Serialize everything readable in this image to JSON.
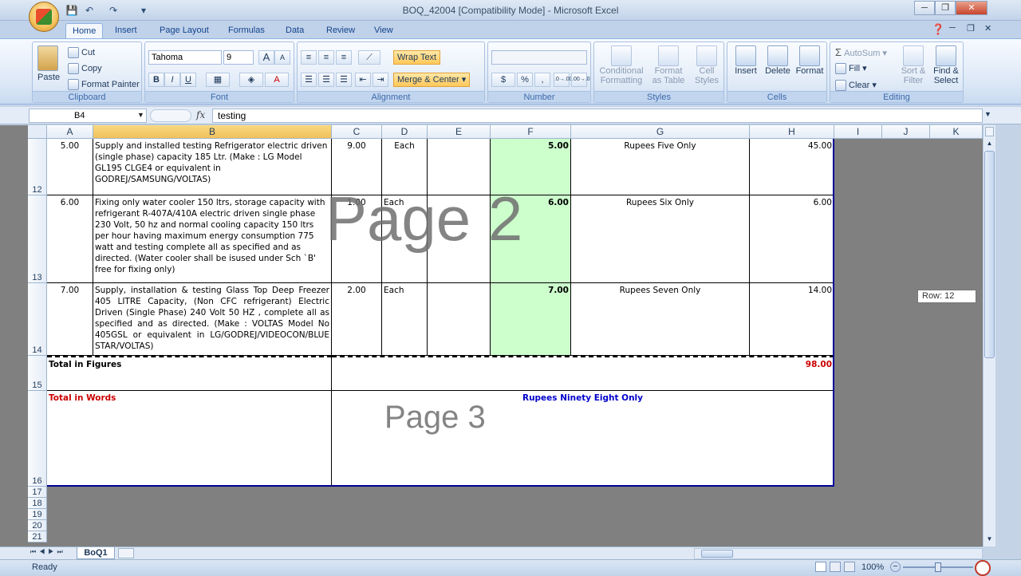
{
  "window": {
    "title": "BOQ_42004  [Compatibility Mode] - Microsoft Excel",
    "minimize": "─",
    "restore": "❐",
    "close": "✕"
  },
  "quick_access": {
    "save": "💾",
    "undo": "↶",
    "redo": "↷",
    "customize": "▾"
  },
  "tabs": [
    "Home",
    "Insert",
    "Page Layout",
    "Formulas",
    "Data",
    "Review",
    "View"
  ],
  "ribbon": {
    "clipboard": {
      "label": "Clipboard",
      "paste": "Paste",
      "cut": "Cut",
      "copy": "Copy",
      "format_painter": "Format Painter"
    },
    "font": {
      "label": "Font",
      "name": "Tahoma",
      "size": "9",
      "grow": "A",
      "shrink": "A",
      "bold": "B",
      "italic": "I",
      "underline": "U",
      "font_color": "A"
    },
    "alignment": {
      "label": "Alignment",
      "wrap_text": "Wrap Text",
      "merge_center": "Merge & Center"
    },
    "number": {
      "label": "Number",
      "currency": "$",
      "percent": "%",
      "comma": ",",
      "inc_dec": ".0→.00",
      "dec_dec": ".00→.0"
    },
    "styles": {
      "label": "Styles",
      "conditional": [
        "Conditional",
        "Formatting"
      ],
      "format_table": [
        "Format",
        "as Table"
      ],
      "cell_styles": [
        "Cell",
        "Styles"
      ]
    },
    "cells": {
      "label": "Cells",
      "insert": "Insert",
      "delete": "Delete",
      "format": "Format"
    },
    "editing": {
      "label": "Editing",
      "autosum": "AutoSum",
      "fill": "Fill",
      "clear": "Clear",
      "sort_filter": [
        "Sort &",
        "Filter"
      ],
      "find_select": [
        "Find &",
        "Select"
      ]
    }
  },
  "formula_bar": {
    "name_box": "B4",
    "fx": "fx",
    "value": "testing"
  },
  "columns": [
    "A",
    "B",
    "C",
    "D",
    "E",
    "F",
    "G",
    "H",
    "I",
    "J",
    "K"
  ],
  "rows": [
    {
      "num": "12",
      "a": "5.00",
      "b": "Supply and  installed testing Refrigerator electric driven (single phase) capacity 185 Ltr. (Make : LG Model GL195 CLGE4 or equivalent in GODREJ/SAMSUNG/VOLTAS)",
      "c": "9.00",
      "d": "Each",
      "f": "5.00",
      "g": "Rupees   Five Only",
      "h": "45.00"
    },
    {
      "num": "13",
      "a": "6.00",
      "b": "Fixing only water cooler 150 ltrs, storage capacity with refrigerant R-407A/410A electric driven single phase 230 Volt, 50 hz and normal cooling capacity 150 ltrs per hour having maximum energy consumption 775 watt and testing complete all as specified and as directed. (Water cooler shall be isused under Sch `B' free for fixing only)",
      "c": "1.00",
      "d": "Each",
      "f": "6.00",
      "g": "Rupees   Six Only",
      "h": "6.00"
    },
    {
      "num": "14",
      "a": "7.00",
      "b": "Supply, installation & testing  Glass Top Deep Freezer 405 LITRE Capacity, (Non CFC refrigerant) Electric Driven (Single Phase) 240 Volt 50 HZ ,  complete all as specified and as directed. (Make : VOLTAS Model No 405GSL or equivalent in LG/GODREJ/VIDEOCON/BLUE STAR/VOLTAS)",
      "c": "2.00",
      "d": "Each",
      "f": "7.00",
      "g": "Rupees   Seven Only",
      "h": "14.00"
    }
  ],
  "total_figures": {
    "num": "15",
    "label": "Total in Figures",
    "value": "98.00"
  },
  "total_words": {
    "num": "16",
    "label": "Total in Words",
    "value": "Rupees   Ninety Eight Only"
  },
  "empty_rows": [
    "17",
    "18",
    "19",
    "20",
    "21"
  ],
  "watermarks": {
    "page2": "Page 2",
    "page3": "Page 3"
  },
  "tooltip": "Row: 12",
  "sheet_tab": "BoQ1",
  "status": {
    "ready": "Ready",
    "zoom": "100%"
  },
  "colors": {
    "total_red": "#cc0000",
    "words_blue": "#0000cc",
    "page_border": "#000099"
  }
}
